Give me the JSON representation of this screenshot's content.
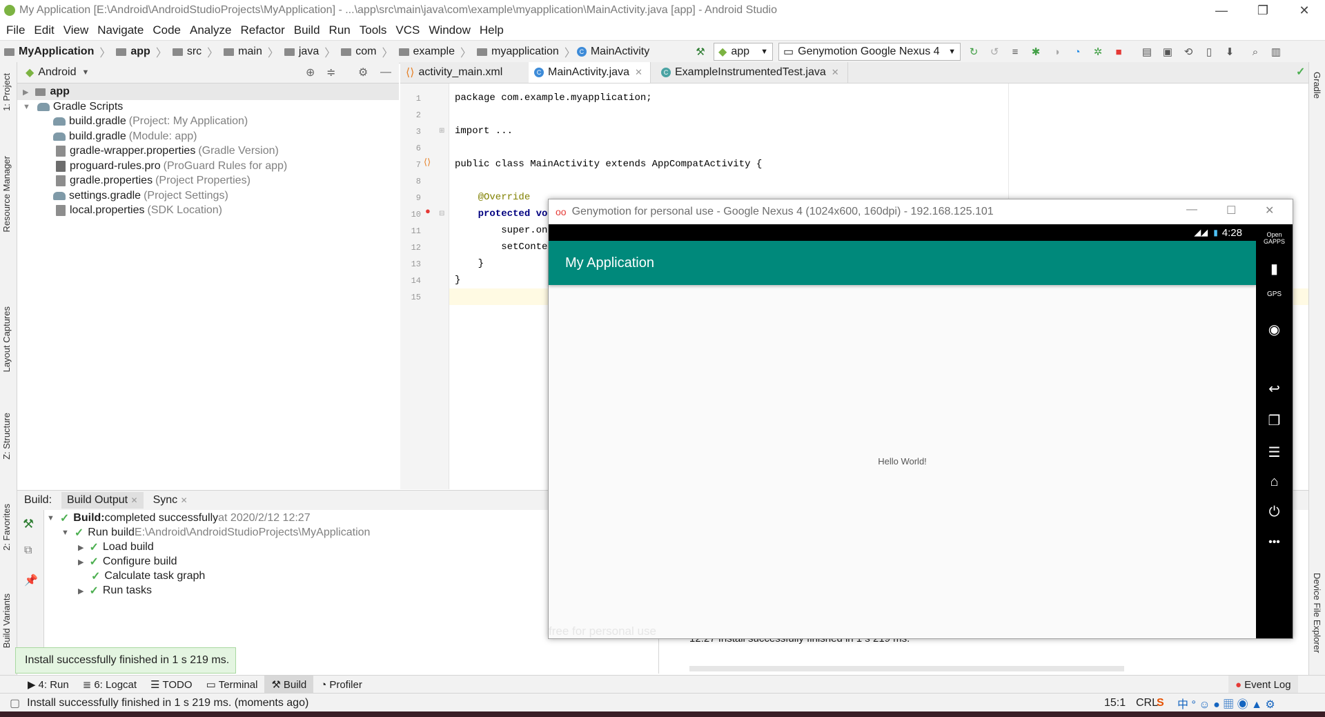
{
  "window": {
    "title": "My Application [E:\\Android\\AndroidStudioProjects\\MyApplication] - ...\\app\\src\\main\\java\\com\\example\\myapplication\\MainActivity.java [app] - Android Studio",
    "minimize": "—",
    "maximize": "❐",
    "close": "✕"
  },
  "menu": [
    "File",
    "Edit",
    "View",
    "Navigate",
    "Code",
    "Analyze",
    "Refactor",
    "Build",
    "Run",
    "Tools",
    "VCS",
    "Window",
    "Help"
  ],
  "breadcrumbs": [
    "MyApplication",
    "app",
    "src",
    "main",
    "java",
    "com",
    "example",
    "myapplication",
    "MainActivity"
  ],
  "run_config": "app",
  "device_config": "Genymotion Google Nexus 4",
  "left_tool_windows": [
    "1: Project",
    "Resource Manager",
    "Layout Captures",
    "Z: Structure",
    "2: Favorites",
    "Build Variants"
  ],
  "right_tool_windows": [
    "Gradle",
    "Device File Explorer"
  ],
  "project": {
    "view_mode": "Android",
    "items": [
      {
        "label": "app",
        "hint": "",
        "kind": "module",
        "level": 0
      },
      {
        "label": "Gradle Scripts",
        "hint": "",
        "kind": "group",
        "level": 0
      },
      {
        "label": "build.gradle",
        "hint": "(Project: My Application)",
        "kind": "gradle",
        "level": 1
      },
      {
        "label": "build.gradle",
        "hint": "(Module: app)",
        "kind": "gradle",
        "level": 1
      },
      {
        "label": "gradle-wrapper.properties",
        "hint": "(Gradle Version)",
        "kind": "props",
        "level": 1
      },
      {
        "label": "proguard-rules.pro",
        "hint": "(ProGuard Rules for app)",
        "kind": "file",
        "level": 1
      },
      {
        "label": "gradle.properties",
        "hint": "(Project Properties)",
        "kind": "props",
        "level": 1
      },
      {
        "label": "settings.gradle",
        "hint": "(Project Settings)",
        "kind": "gradle",
        "level": 1
      },
      {
        "label": "local.properties",
        "hint": "(SDK Location)",
        "kind": "props",
        "level": 1
      }
    ]
  },
  "editor": {
    "tabs": [
      {
        "label": "activity_main.xml",
        "active": false
      },
      {
        "label": "MainActivity.java",
        "active": true
      },
      {
        "label": "ExampleInstrumentedTest.java",
        "active": false
      }
    ],
    "lines": [
      {
        "n": "1",
        "text": "package com.example.myapplication;"
      },
      {
        "n": "2",
        "text": ""
      },
      {
        "n": "3",
        "text": "import ..."
      },
      {
        "n": "6",
        "text": ""
      },
      {
        "n": "7",
        "text": "public class MainActivity extends AppCompatActivity {"
      },
      {
        "n": "8",
        "text": ""
      },
      {
        "n": "9",
        "text": "    @Override"
      },
      {
        "n": "10",
        "text": "    protected voi"
      },
      {
        "n": "11",
        "text": "        super.onC"
      },
      {
        "n": "12",
        "text": "        setConten"
      },
      {
        "n": "13",
        "text": "    }"
      },
      {
        "n": "14",
        "text": "}"
      },
      {
        "n": "15",
        "text": ""
      }
    ]
  },
  "build": {
    "label": "Build:",
    "tabs": [
      "Build Output",
      "Sync"
    ],
    "rows": [
      {
        "bold": "Build:",
        "text": " completed successfully",
        "hint": " at 2020/2/12 12:27",
        "level": 0,
        "expand": "▼"
      },
      {
        "bold": "",
        "text": "Run build",
        "hint": " E:\\Android\\AndroidStudioProjects\\MyApplication",
        "level": 1,
        "expand": "▼"
      },
      {
        "bold": "",
        "text": "Load build",
        "hint": "",
        "level": 2,
        "expand": "▶"
      },
      {
        "bold": "",
        "text": "Configure build",
        "hint": "",
        "level": 2,
        "expand": "▶"
      },
      {
        "bold": "",
        "text": "Calculate task graph",
        "hint": "",
        "level": 2,
        "expand": ""
      },
      {
        "bold": "",
        "text": "Run tasks",
        "hint": "",
        "level": 2,
        "expand": "▶"
      }
    ],
    "right_log": "12:27  Install successfully finished in 1 s 219 ms."
  },
  "toast": "Install successfully finished in 1 s 219 ms.",
  "bottom_tabs": [
    "4: Run",
    "6: Logcat",
    "TODO",
    "Terminal",
    "Build",
    "Profiler"
  ],
  "event_log": "Event Log",
  "status": {
    "message": "Install successfully finished in 1 s 219 ms. (moments ago)",
    "position": "15:1",
    "line_sep": "CRL"
  },
  "genymotion": {
    "title": "Genymotion for personal use - Google Nexus 4 (1024x600, 160dpi) - 192.168.125.101",
    "clock": "4:28",
    "app_title": "My Application",
    "hello": "Hello World!",
    "watermark": "free for personal use",
    "side_top": "Open GAPPS",
    "gps": "GPS"
  }
}
